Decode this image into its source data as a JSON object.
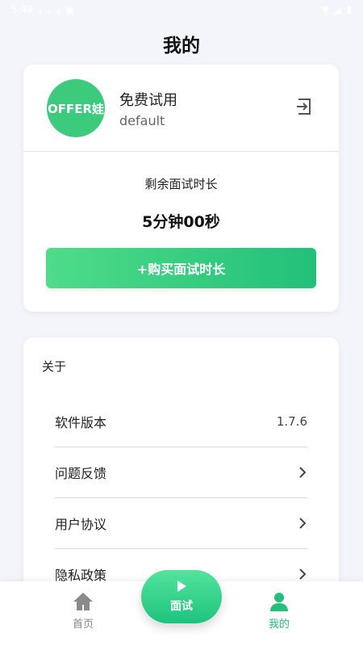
{
  "status_bar": {
    "time": "5:49"
  },
  "title": "我的",
  "profile": {
    "avatar_text": "OFFER娃",
    "name": "免费试用",
    "sub": "default"
  },
  "remain": {
    "label": "剩余面试时长",
    "value": "5分钟00秒",
    "buy_label": "+购买面试时长"
  },
  "about": {
    "title": "关于",
    "rows": [
      {
        "label": "软件版本",
        "value": "1.7.6"
      },
      {
        "label": "问题反馈"
      },
      {
        "label": "用户协议"
      },
      {
        "label": "隐私政策"
      }
    ]
  },
  "nav": {
    "home": "首页",
    "interview": "面试",
    "mine": "我的"
  },
  "colors": {
    "accent": "#22c07a",
    "nav_inactive": "#888888"
  }
}
